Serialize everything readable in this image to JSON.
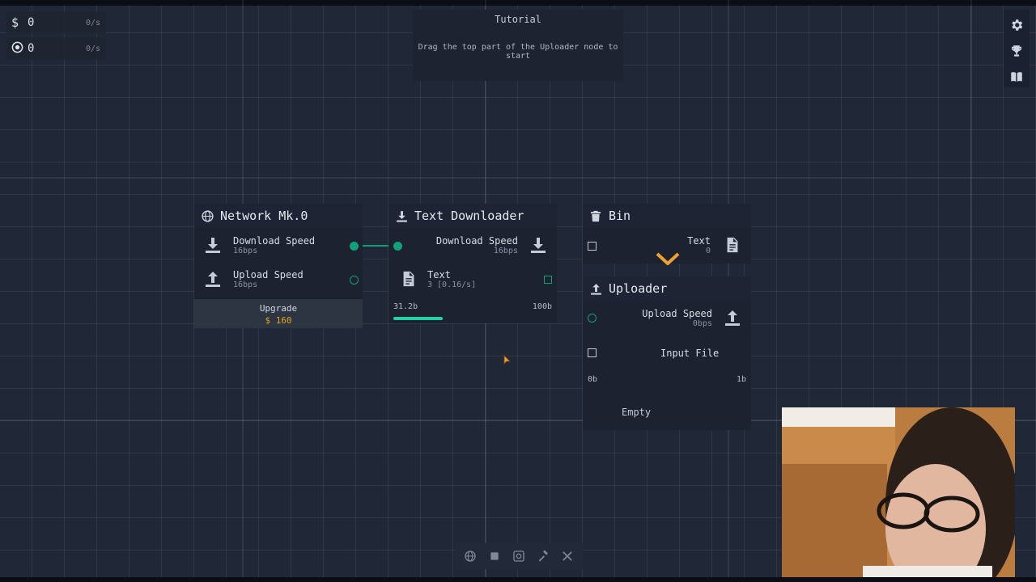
{
  "resources": [
    {
      "icon": "dollar-icon",
      "value": "0",
      "rate": "0/s"
    },
    {
      "icon": "target-icon",
      "value": "0",
      "rate": "0/s"
    }
  ],
  "tutorial": {
    "title": "Tutorial",
    "text": "Drag the top part of the Uploader node to start"
  },
  "nodes": {
    "network": {
      "title": "Network Mk.0",
      "download_label": "Download Speed",
      "download_value": "16bps",
      "upload_label": "Upload Speed",
      "upload_value": "16bps",
      "upgrade_label": "Upgrade",
      "upgrade_cost": "160"
    },
    "downloader": {
      "title": "Text Downloader",
      "download_label": "Download Speed",
      "download_value": "16bps",
      "text_label": "Text",
      "text_value": "3 [0.16/s]",
      "progress_current": "31.2b",
      "progress_max": "100b",
      "progress_fraction": 0.312
    },
    "bin": {
      "title": "Bin",
      "text_label": "Text",
      "text_value": "0"
    },
    "uploader": {
      "title": "Uploader",
      "upload_label": "Upload Speed",
      "upload_value": "0bps",
      "input_label": "Input File",
      "range_min": "0b",
      "range_max": "1b",
      "status": "Empty"
    }
  },
  "colors": {
    "accent": "#12a07a",
    "progress": "#22d3a8",
    "currency": "#e0a526",
    "pointer": "#f0a030"
  }
}
